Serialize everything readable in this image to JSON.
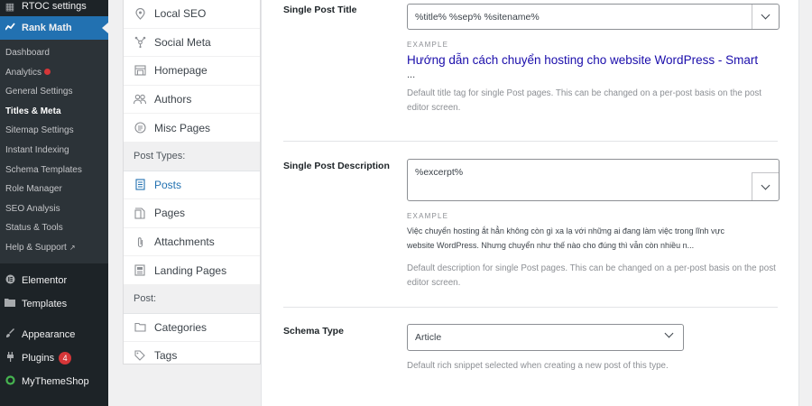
{
  "sidebar": {
    "top_item": "RTOC settings",
    "rank_math": "Rank Math",
    "submenu": [
      {
        "label": "Dashboard"
      },
      {
        "label": "Analytics"
      },
      {
        "label": "General Settings"
      },
      {
        "label": "Titles & Meta"
      },
      {
        "label": "Sitemap Settings"
      },
      {
        "label": "Instant Indexing"
      },
      {
        "label": "Schema Templates"
      },
      {
        "label": "Role Manager"
      },
      {
        "label": "SEO Analysis"
      },
      {
        "label": "Status & Tools"
      },
      {
        "label": "Help & Support"
      }
    ],
    "group2": [
      {
        "label": "Elementor"
      },
      {
        "label": "Templates"
      }
    ],
    "group3": [
      {
        "label": "Appearance"
      },
      {
        "label": "Plugins",
        "badge": "4"
      },
      {
        "label": "MyThemeShop"
      }
    ]
  },
  "settings_nav": {
    "items_top": [
      {
        "label": "Local SEO",
        "icon": "location-pin-icon"
      },
      {
        "label": "Social Meta",
        "icon": "social-share-icon"
      },
      {
        "label": "Homepage",
        "icon": "home-icon"
      },
      {
        "label": "Authors",
        "icon": "users-icon"
      },
      {
        "label": "Misc Pages",
        "icon": "misc-pages-icon"
      }
    ],
    "section_post_types": "Post Types:",
    "items_post_types": [
      {
        "label": "Posts",
        "icon": "document-icon"
      },
      {
        "label": "Pages",
        "icon": "page-icon"
      },
      {
        "label": "Attachments",
        "icon": "paperclip-icon"
      },
      {
        "label": "Landing Pages",
        "icon": "landing-page-icon"
      }
    ],
    "section_post": "Post:",
    "items_post": [
      {
        "label": "Categories",
        "icon": "folder-icon"
      },
      {
        "label": "Tags",
        "icon": "tag-icon"
      }
    ]
  },
  "main": {
    "post_title": {
      "label": "Single Post Title",
      "value": "%title% %sep% %sitename%",
      "example_label": "EXAMPLE",
      "example_title_line1": "Hướng dẫn cách chuyển hosting cho website WordPress - Smart",
      "example_title_line2": "...",
      "description": "Default title tag for single Post pages. This can be changed on a per-post basis on the post editor screen."
    },
    "post_description": {
      "label": "Single Post Description",
      "value": "%excerpt%",
      "example_label": "EXAMPLE",
      "example_line1": "Việc chuyển hosting ắt hẳn không còn gì xa lạ với những ai đang làm việc trong lĩnh vực",
      "example_line2": "website WordPress. Nhưng chuyển như thế nào cho đúng thì vẫn còn nhiều n...",
      "description": "Default description for single Post pages. This can be changed on a per-post basis on the post editor screen."
    },
    "schema_type": {
      "label": "Schema Type",
      "value": "Article",
      "description": "Default rich snippet selected when creating a new post of this type."
    }
  },
  "colors": {
    "admin_sidebar": "#1d2327",
    "accent_blue": "#2271b1",
    "example_link": "#1a0dab",
    "badge_red": "#d63638"
  }
}
